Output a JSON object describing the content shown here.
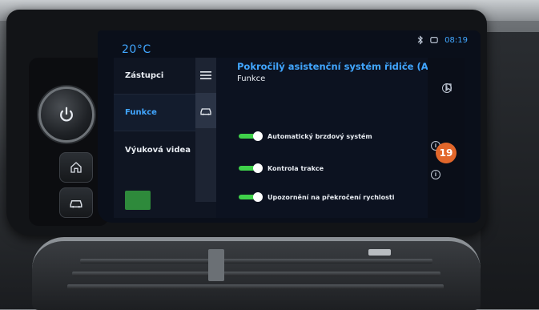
{
  "status": {
    "temperature": "20°C",
    "time": "08:19"
  },
  "menu": {
    "items": [
      {
        "label": "Zástupci",
        "active": false
      },
      {
        "label": "Funkce",
        "active": true
      },
      {
        "label": "Výuková videa",
        "active": false
      }
    ]
  },
  "content": {
    "title": "Pokročilý asistenční systém řidiče (ADAS)",
    "subtitle": "Funkce",
    "options": [
      {
        "label": "Automatický brzdový systém",
        "on": true
      },
      {
        "label": "Kontrola trakce",
        "on": true
      },
      {
        "label": "Upozornění na překročení rychlosti",
        "on": true
      }
    ]
  },
  "badge": {
    "value": "19"
  },
  "colors": {
    "accent": "#41a6ff",
    "toggle_on": "#3fd14a",
    "badge": "#e2672b"
  },
  "icons": [
    "power-icon",
    "home-icon",
    "car-icon",
    "menu-icon",
    "bluetooth-icon",
    "phone-icon",
    "info-icon",
    "bookmark-icon"
  ]
}
